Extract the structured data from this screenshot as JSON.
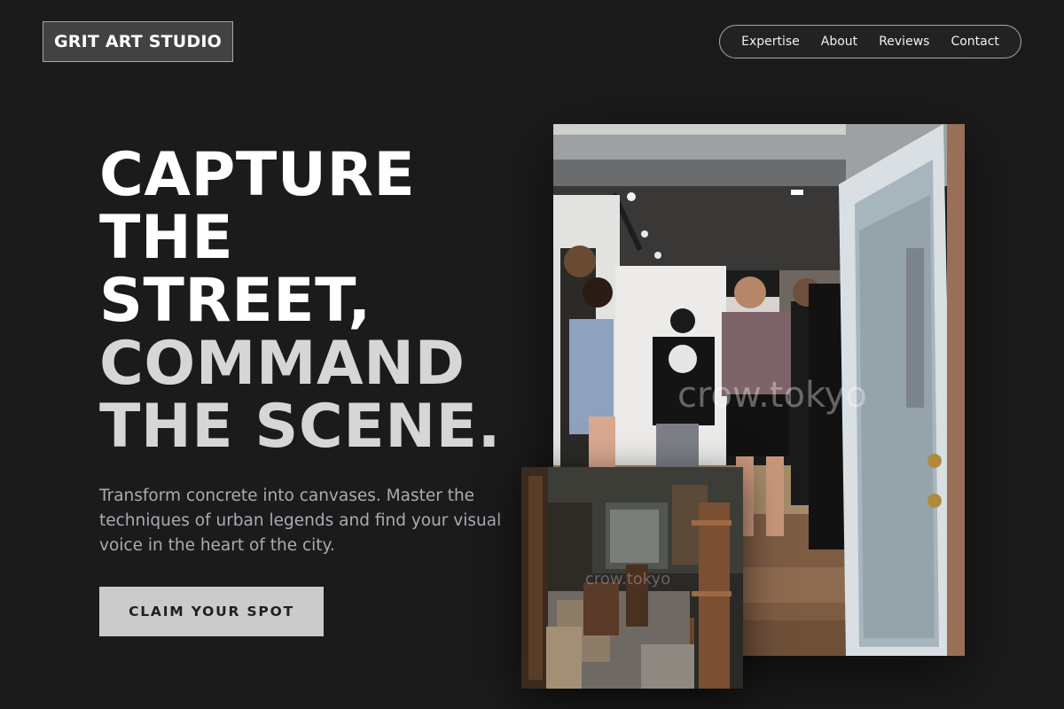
{
  "brand": {
    "name": "GRIT ART STUDIO"
  },
  "nav": {
    "items": [
      {
        "label": "Expertise"
      },
      {
        "label": "About"
      },
      {
        "label": "Reviews"
      },
      {
        "label": "Contact"
      }
    ]
  },
  "hero": {
    "headline_lines": [
      "CAPTURE",
      "THE",
      "STREET,",
      "COMMAND",
      "THE SCENE."
    ],
    "subtext": "Transform concrete into canvases. Master the techniques of urban legends and find your visual voice in the heart of the city.",
    "cta_label": "CLAIM YOUR SPOT"
  },
  "images": {
    "main_watermark": "crow.tokyo",
    "inset_watermark": "crow.tokyo"
  },
  "colors": {
    "background": "#1b1b1c",
    "headline_white": "#ffffff",
    "headline_grey": "#d6d6d6",
    "subtext": "#a9acb3",
    "cta_background": "#cbcbcb",
    "logo_background": "#424242"
  }
}
